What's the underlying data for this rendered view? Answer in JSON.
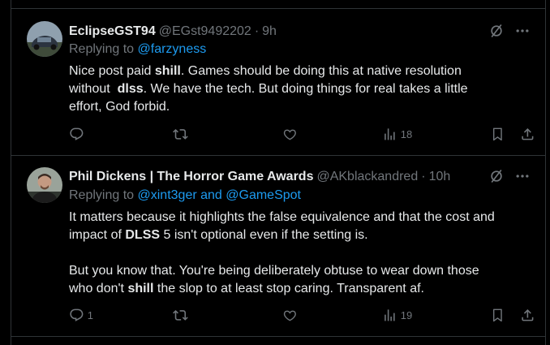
{
  "posts": [
    {
      "name": "EclipseGST94",
      "handle": "@EGst9492202",
      "time": "9h",
      "replying_prefix": "Replying to",
      "replying_to": "@farzyness",
      "body": {
        "l1_a": "Nice post paid ",
        "l1_b": "shill",
        "l1_c": ". Games should be doing this at native resolution",
        "l2_a": "without  ",
        "l2_b": "dlss",
        "l2_c": ". We have the tech. But doing things for real takes a little",
        "l3": "effort, God forbid."
      },
      "reply_count": "",
      "views": "18"
    },
    {
      "name": "Phil Dickens | The Horror Game Awards",
      "handle": "@AKblackandred",
      "time": "10h",
      "replying_prefix": "Replying to",
      "replying_to": "@xint3ger and @GameSpot",
      "body": {
        "p1l1": "It matters because it highlights the false equivalence and that the cost and",
        "p1l2_a": "impact of ",
        "p1l2_b": "DLSS",
        "p1l2_c": " 5 isn't optional even if the setting is.",
        "p2l1": "But you know that. You're being deliberately obtuse to wear down those",
        "p2l2_a": "who don't ",
        "p2l2_b": "shill",
        "p2l2_c": " the slop to at least stop caring. Transparent af."
      },
      "reply_count": "1",
      "views": "19"
    }
  ],
  "icons": [
    "grok-icon",
    "more-icon",
    "reply-icon",
    "repost-icon",
    "like-icon",
    "views-icon",
    "bookmark-icon",
    "share-icon"
  ],
  "colors": {
    "background": "#000000",
    "text": "#e7e9ea",
    "muted": "#71767b",
    "link": "#1d9bf0",
    "border": "#2f3336"
  }
}
